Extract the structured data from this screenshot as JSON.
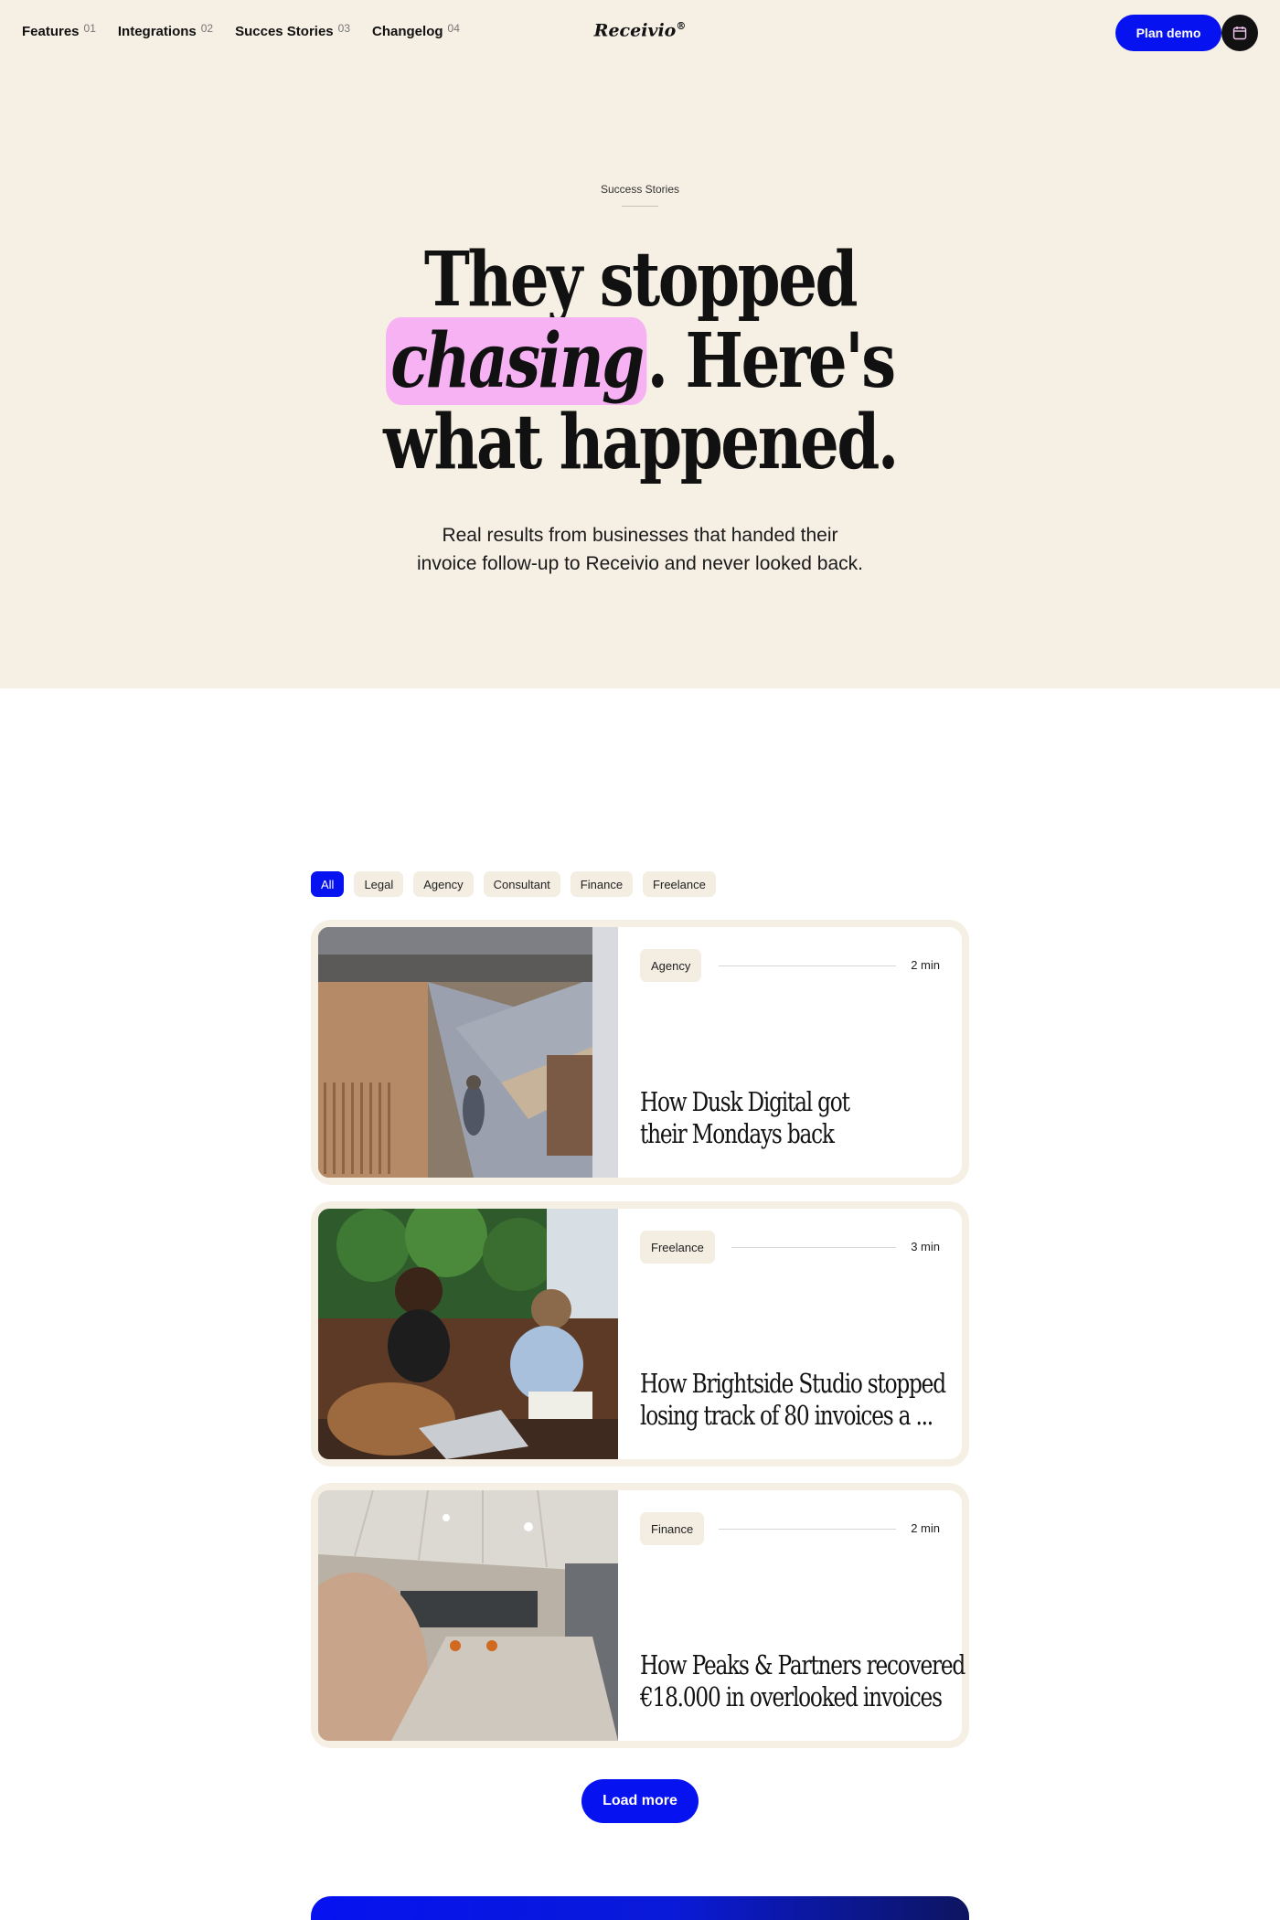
{
  "nav": {
    "items": [
      {
        "label": "Features",
        "num": "01"
      },
      {
        "label": "Integrations",
        "num": "02"
      },
      {
        "label": "Succes Stories",
        "num": "03"
      },
      {
        "label": "Changelog",
        "num": "04"
      }
    ],
    "logo": "Receivio",
    "logo_mark": "®",
    "plan_demo": "Plan demo",
    "calendar_icon": "calendar-icon"
  },
  "hero": {
    "eyebrow": "Success Stories",
    "headline_line1": "They stopped",
    "headline_highlight": "chasing",
    "headline_line2_rest": ". Here's",
    "headline_line3": "what happened.",
    "sub_line1": "Real results from businesses that handed their",
    "sub_line2": "invoice follow-up to Receivio and never looked back.",
    "highlight_color": "#f6b2f3",
    "background": "#f5efe4"
  },
  "filters": [
    {
      "label": "All",
      "active": true
    },
    {
      "label": "Legal",
      "active": false
    },
    {
      "label": "Agency",
      "active": false
    },
    {
      "label": "Consultant",
      "active": false
    },
    {
      "label": "Finance",
      "active": false
    },
    {
      "label": "Freelance",
      "active": false
    }
  ],
  "stories": [
    {
      "tag": "Agency",
      "time": "2 min",
      "title_line1": "How Dusk Digital got",
      "title_line2": "their Mondays back",
      "image": "office-atrium-photo"
    },
    {
      "tag": "Freelance",
      "time": "3 min",
      "title_line1": "How Brightside Studio stopped",
      "title_line2": "losing track of 80 invoices a ...",
      "image": "two-women-laptop-photo"
    },
    {
      "tag": "Finance",
      "time": "2 min",
      "title_line1": "How Peaks & Partners recovered",
      "title_line2": "€18.000 in overlooked invoices",
      "image": "office-lobby-photo"
    }
  ],
  "load_more": "Load more",
  "accent": "#0612f0"
}
